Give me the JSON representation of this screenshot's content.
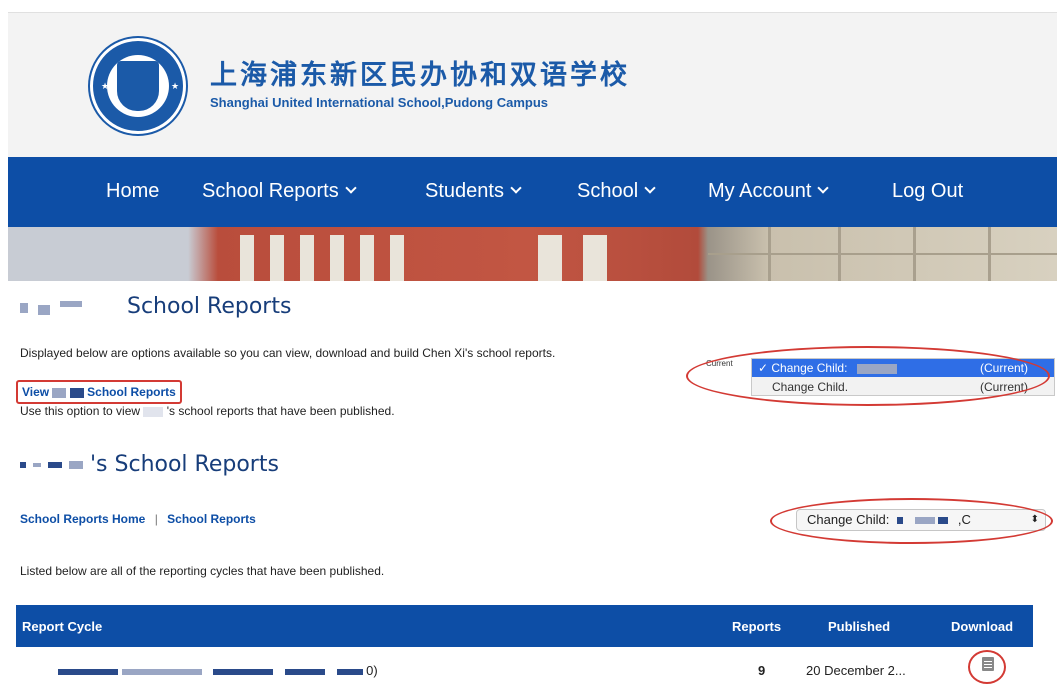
{
  "header": {
    "school_name_cn": "上海浦东新区民办协和双语学校",
    "school_name_en": "Shanghai United International School,Pudong Campus"
  },
  "nav": {
    "items": [
      {
        "label": "Home",
        "dropdown": false
      },
      {
        "label": "School Reports",
        "dropdown": true
      },
      {
        "label": "Students",
        "dropdown": true
      },
      {
        "label": "School",
        "dropdown": true
      },
      {
        "label": "My Account",
        "dropdown": true
      },
      {
        "label": "Log Out",
        "dropdown": false
      }
    ]
  },
  "section1": {
    "title": "School Reports",
    "description": "Displayed below are options available so you can view, download and build Chen Xi's school reports.",
    "view_link_prefix": "View",
    "view_link_suffix": "School Reports",
    "option_desc_prefix": "Use this option to view",
    "option_desc_suffix": "'s school reports that have been published."
  },
  "child_dropdown": {
    "current_label": "Current",
    "options": [
      {
        "label": "Change Child:",
        "suffix": "(Current)",
        "selected": true
      },
      {
        "label": "Change Child.",
        "suffix": "(Current)",
        "selected": false
      }
    ]
  },
  "section2": {
    "title": "'s School Reports",
    "breadcrumb": [
      "School Reports Home",
      "School Reports"
    ],
    "breadcrumb_sep": "|",
    "select_label": "Change Child:",
    "select_suffix": ",C",
    "select_arrow": "⬍",
    "listed_text": "Listed below are all of the reporting cycles that have been published."
  },
  "table": {
    "headers": [
      "Report Cycle",
      "Reports",
      "Published",
      "Download"
    ],
    "rows": [
      {
        "cycle_suffix": "0)",
        "reports": "9",
        "published": "20 December 2...",
        "download_icon": "document-icon"
      }
    ]
  },
  "colors": {
    "nav_blue": "#0d4ea6",
    "heading_blue": "#173d7a",
    "annotation_red": "#d33a34",
    "selection_blue": "#2f6ee6"
  }
}
